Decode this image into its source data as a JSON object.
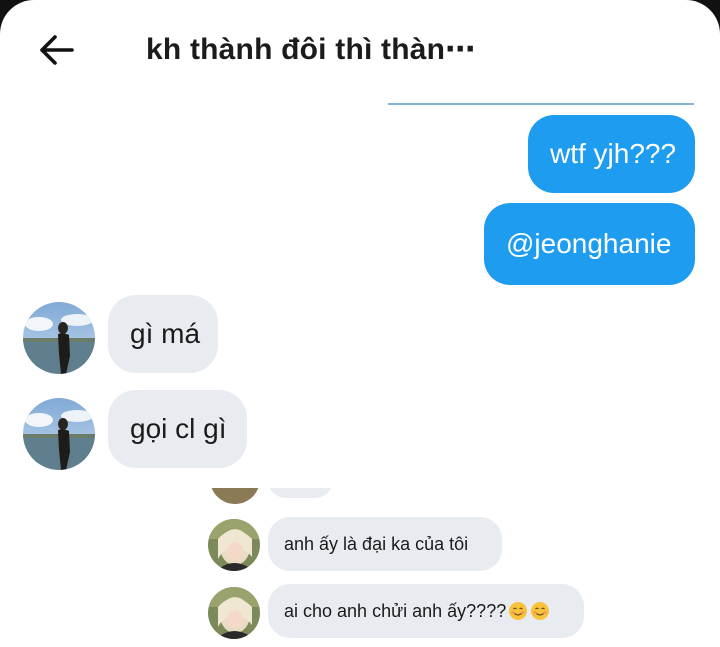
{
  "header": {
    "title": "kh thành đôi thì thàn⋯"
  },
  "messages": {
    "sent": [
      {
        "text": "wtf yjh???"
      },
      {
        "text": "@jeonghanie"
      }
    ],
    "received": [
      {
        "text": "gì má"
      },
      {
        "text": "gọi cl gì"
      }
    ],
    "embedded": [
      {
        "text": "anh ấy là đại ka của tôi"
      },
      {
        "text": "ai cho anh chửi anh ấy????"
      }
    ]
  },
  "icons": {
    "back": "arrow-left-icon",
    "emoji": "smiling-face-icon"
  },
  "colors": {
    "sent_bubble": "#1e9cf0",
    "received_bubble": "#e8ebf0",
    "text": "#1b1b1b"
  }
}
